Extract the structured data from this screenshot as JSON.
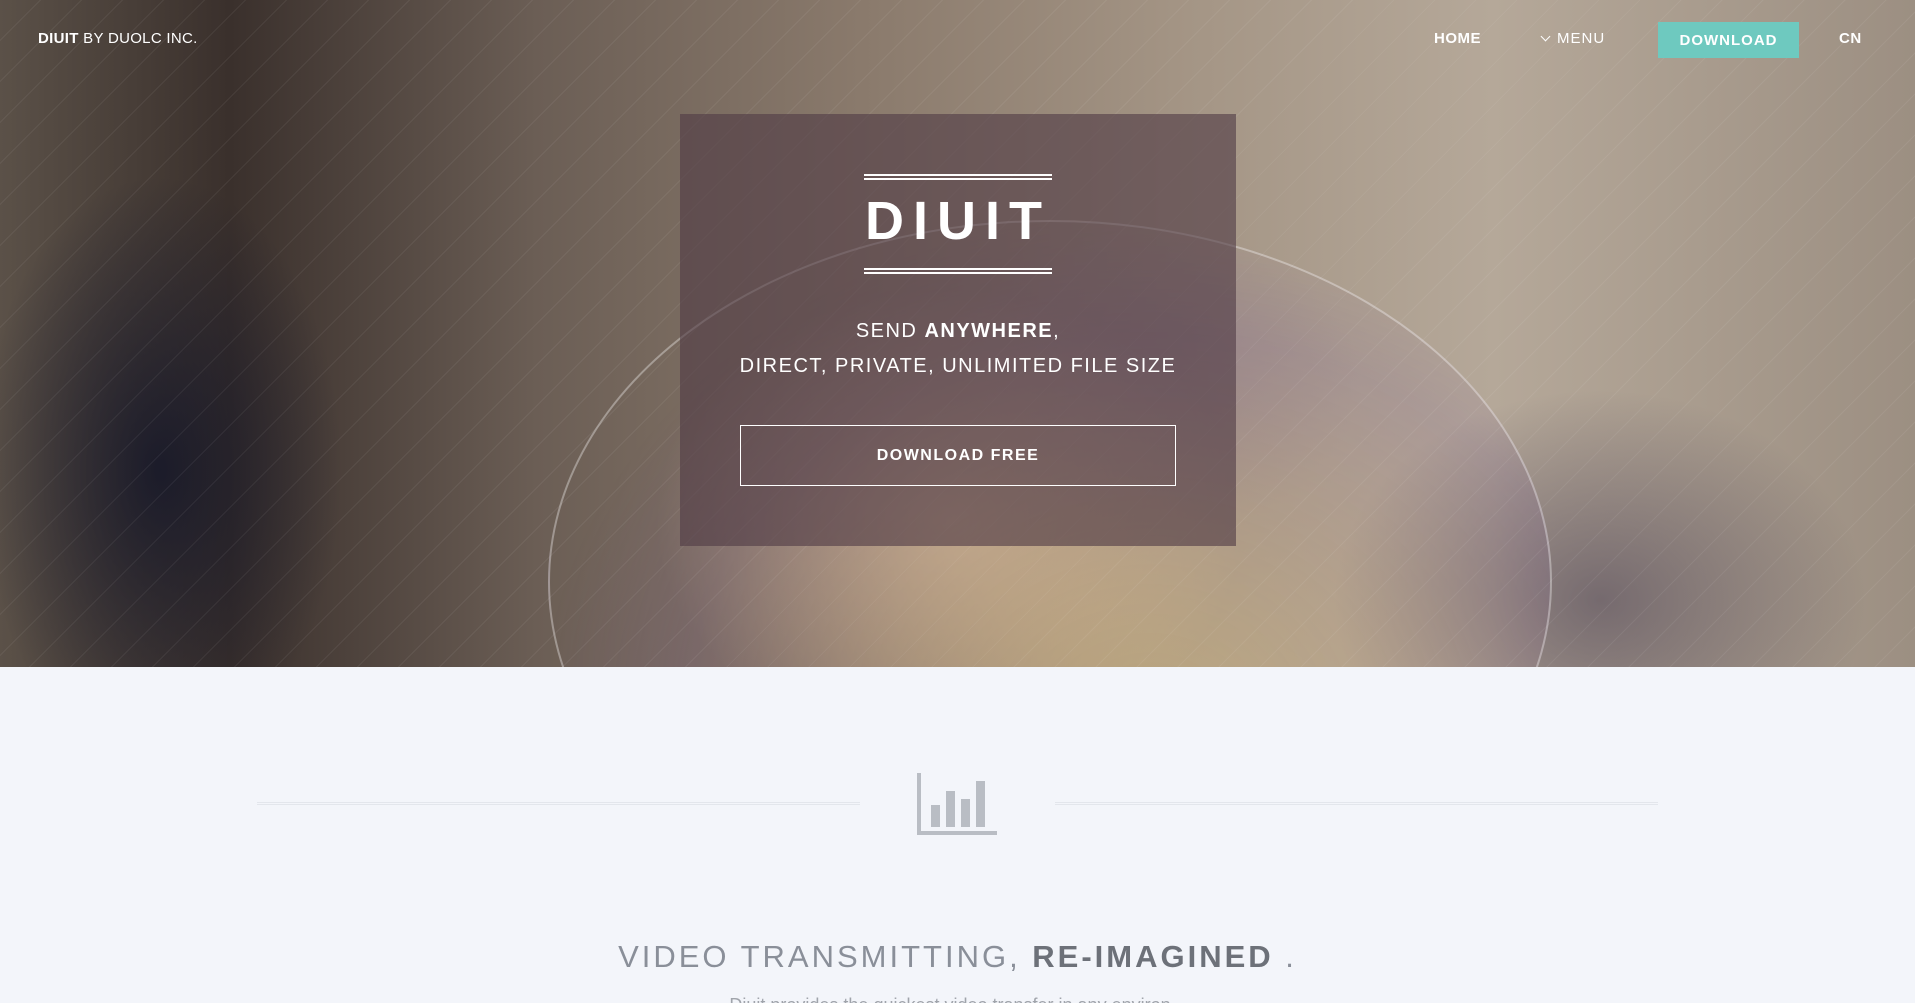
{
  "nav": {
    "brand_name": "DIUIT",
    "brand_suffix": " BY DUOLC INC.",
    "home": "HOME",
    "menu": "MENU",
    "download": "DOWNLOAD",
    "lang": "CN"
  },
  "hero": {
    "title": "DIUIT",
    "tagline_prefix": "SEND ",
    "tagline_bold": "ANYWHERE",
    "tagline_suffix": ",",
    "tagline_line2": "DIRECT, PRIVATE, UNLIMITED FILE SIZE",
    "cta": "DOWNLOAD FREE"
  },
  "section": {
    "icon": "bar-chart-icon",
    "headline_light": "VIDEO TRANSMITTING, ",
    "headline_bold": "RE-IMAGINED",
    "headline_end": " .",
    "body_partial": "Diuit provides the quickest video transfer in any environ..."
  },
  "colors": {
    "accent": "#6ec9bf",
    "panel": "#50384a",
    "section_bg": "#f3f5fa",
    "heading": "#8a8f99"
  }
}
